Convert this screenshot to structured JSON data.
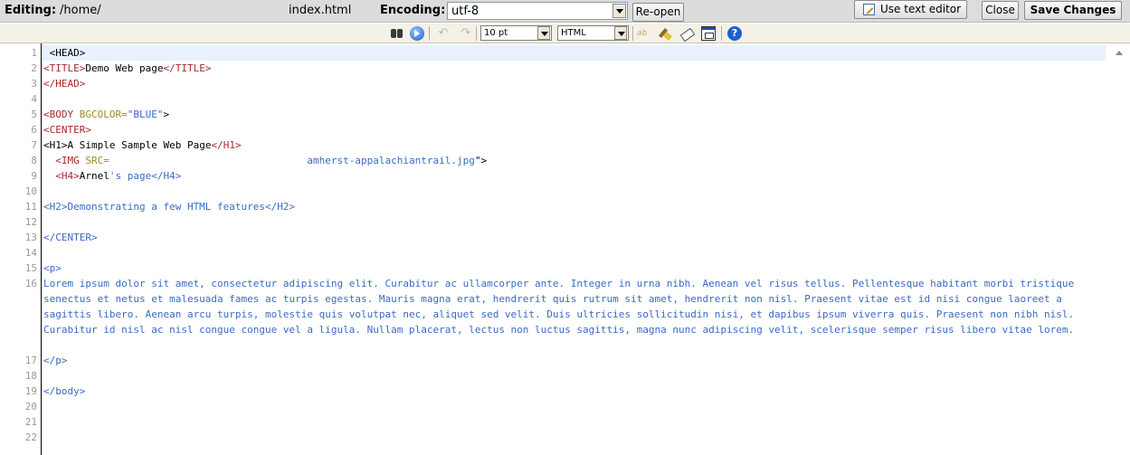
{
  "topbar": {
    "editing_label": "Editing:",
    "path": "/home/",
    "filename": "index.html",
    "encoding_label": "Encoding:",
    "encoding_value": "utf-8",
    "reopen": "Re-open",
    "text_editor": "Use text editor",
    "close": "Close",
    "save": "Save Changes"
  },
  "toolbar": {
    "font_size": "10 pt",
    "syntax": "HTML",
    "spell_glyph": "ab",
    "help_glyph": "?",
    "undo_glyph": "↶",
    "redo_glyph": "↷",
    "icons": [
      "find-icon",
      "goto-line-icon",
      "undo-icon",
      "redo-icon",
      "spellcheck-icon",
      "cleanup-icon",
      "eraser-icon",
      "fullscreen-icon",
      "help-icon"
    ]
  },
  "editor": {
    "active_line": 1,
    "lines": [
      {
        "n": "1",
        "segs": [
          {
            "t": " <HEAD>",
            "c": ""
          }
        ]
      },
      {
        "n": "2",
        "segs": [
          {
            "t": "<TITLE>",
            "c": "tag"
          },
          {
            "t": "Demo Web page",
            "c": ""
          },
          {
            "t": "</TITLE>",
            "c": "tag"
          }
        ]
      },
      {
        "n": "3",
        "segs": [
          {
            "t": "</HEAD>",
            "c": "tag"
          }
        ]
      },
      {
        "n": "4",
        "segs": []
      },
      {
        "n": "5",
        "segs": [
          {
            "t": "<BODY ",
            "c": "tag"
          },
          {
            "t": "BGCOLOR=",
            "c": "attr"
          },
          {
            "t": "\"BLUE\"",
            "c": "val"
          },
          {
            "t": ">",
            "c": ""
          }
        ]
      },
      {
        "n": "6",
        "segs": [
          {
            "t": "<CENTER>",
            "c": "tag"
          }
        ]
      },
      {
        "n": "7",
        "segs": [
          {
            "t": "<H1>",
            "c": ""
          },
          {
            "t": "A Simple Sample Web Page",
            "c": ""
          },
          {
            "t": "</H1>",
            "c": "tag"
          }
        ]
      },
      {
        "n": "8",
        "segs": [
          {
            "t": "  <IMG ",
            "c": "tag"
          },
          {
            "t": "SRC=",
            "c": "attr"
          },
          {
            "t": "                                 ",
            "c": ""
          },
          {
            "t": "amherst-appalachiantrail.jpg",
            "c": "val"
          },
          {
            "t": "\">",
            "c": ""
          }
        ]
      },
      {
        "n": "9",
        "segs": [
          {
            "t": "  <H4>",
            "c": "tag"
          },
          {
            "t": "Arnel",
            "c": ""
          },
          {
            "t": "'s page</H4>",
            "c": "blue"
          }
        ]
      },
      {
        "n": "10",
        "segs": []
      },
      {
        "n": "11",
        "segs": [
          {
            "t": "<H2>Demonstrating a few HTML features</H2>",
            "c": "blue"
          }
        ]
      },
      {
        "n": "12",
        "segs": []
      },
      {
        "n": "13",
        "segs": [
          {
            "t": "</CENTER>",
            "c": "blue"
          }
        ]
      },
      {
        "n": "14",
        "segs": []
      },
      {
        "n": "15",
        "segs": [
          {
            "t": "<p>",
            "c": "blue"
          }
        ]
      },
      {
        "n": "16",
        "wrap": true,
        "segs": [
          {
            "t": "Lorem ipsum dolor sit amet, consectetur adipiscing elit. Curabitur ac ullamcorper ante. Integer in urna nibh. Aenean vel risus tellus. Pellentesque habitant morbi tristique senectus et netus et malesuada fames ac turpis egestas. Mauris magna erat, hendrerit quis rutrum sit amet, hendrerit non nisl. Praesent vitae est id nisi congue laoreet a sagittis libero. Aenean arcu turpis, molestie quis volutpat nec, aliquet sed velit. Duis ultricies sollicitudin nisi, et dapibus ipsum viverra quis. Praesent non nibh nisl. Curabitur id nisl ac nisl congue congue vel a ligula. Nullam placerat, lectus non luctus sagittis, magna nunc adipiscing velit, scelerisque semper risus libero vitae lorem.",
            "c": "blue"
          }
        ]
      },
      {
        "n": "17",
        "segs": [
          {
            "t": "</p>",
            "c": "blue"
          }
        ]
      },
      {
        "n": "18",
        "segs": []
      },
      {
        "n": "19",
        "segs": [
          {
            "t": "</body>",
            "c": "blue"
          }
        ]
      },
      {
        "n": "20",
        "segs": []
      },
      {
        "n": "21",
        "segs": []
      },
      {
        "n": "22",
        "segs": []
      }
    ]
  }
}
